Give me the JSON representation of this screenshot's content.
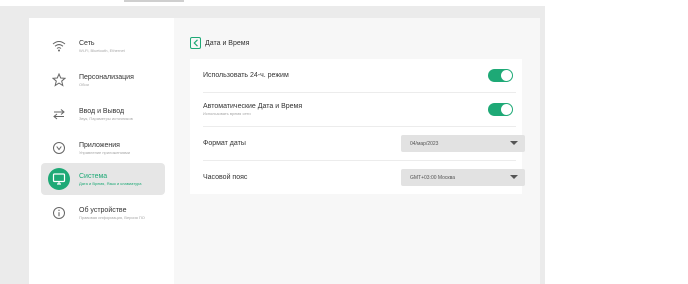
{
  "colors": {
    "accent": "#1ea976"
  },
  "sidebar": {
    "items": [
      {
        "title": "Сеть",
        "sub": "Wi-Fi, Bluetooth, Ethernet",
        "icon": "wifi-icon",
        "active": false
      },
      {
        "title": "Персонализация",
        "sub": "Обои",
        "icon": "star-icon",
        "active": false
      },
      {
        "title": "Ввод и Вывод",
        "sub": "Звук, Параметры источников",
        "icon": "input-output-icon",
        "active": false
      },
      {
        "title": "Приложения",
        "sub": "Управление приложениями",
        "icon": "apps-icon",
        "active": false
      },
      {
        "title": "Система",
        "sub": "Дата и Время, Язык и клавиатура",
        "icon": "monitor-icon",
        "active": true
      },
      {
        "title": "Об устройстве",
        "sub": "Правовая информация, Версия ПО",
        "icon": "info-icon",
        "active": false
      }
    ]
  },
  "header": {
    "title": "Дата и Время"
  },
  "settings": {
    "use24h": {
      "label": "Использовать 24-ч. режим",
      "enabled": true
    },
    "autoDateTime": {
      "label": "Автоматические Дата и Время",
      "sub": "Использовать время сети",
      "enabled": true
    },
    "dateFormat": {
      "label": "Формат даты",
      "value": "04/мар/2023"
    },
    "timezone": {
      "label": "Часовой пояс",
      "value": "GMT+03:00 Москва"
    }
  }
}
